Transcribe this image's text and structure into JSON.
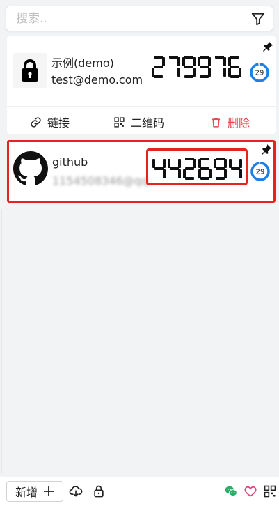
{
  "search": {
    "placeholder": "搜索.."
  },
  "accounts": [
    {
      "name": "示例(demo)",
      "email": "test@demo.com",
      "code": "279976",
      "remaining": "29",
      "remaining_fraction": 0.97,
      "logo": "lock-icon",
      "actions": {
        "link": "链接",
        "qrcode": "二维码",
        "delete": "删除"
      }
    },
    {
      "name": "github",
      "email": "1154508346@qq",
      "code": "442694",
      "remaining": "29",
      "remaining_fraction": 0.97,
      "logo": "github-icon"
    }
  ],
  "bottom": {
    "add_label": "新增"
  },
  "colors": {
    "accent": "#1e80e5",
    "danger": "#e5474a",
    "highlight": "#e5231f",
    "wechat": "#2aae67",
    "heart": "#e0447e"
  }
}
